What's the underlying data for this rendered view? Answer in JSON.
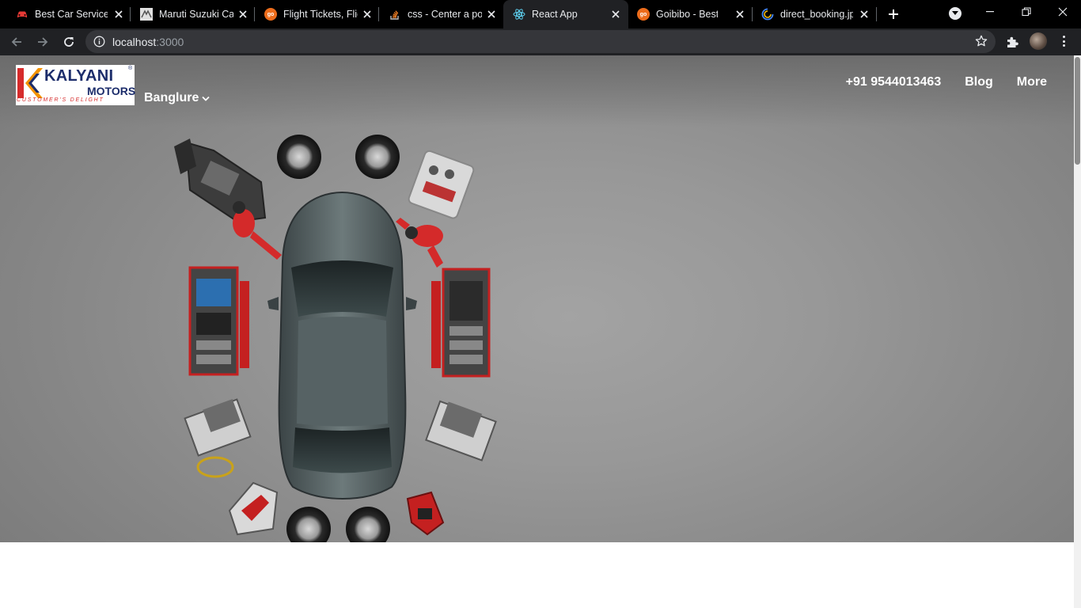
{
  "browser": {
    "tabs": [
      {
        "title": "Best Car Service |",
        "icon": "car-icon",
        "active": false
      },
      {
        "title": "Maruti Suzuki Car",
        "icon": "maruti-suzuki-icon",
        "active": false
      },
      {
        "title": "Flight Tickets, Flig",
        "icon": "goibibo-icon",
        "active": false
      },
      {
        "title": "css - Center a pos",
        "icon": "stackoverflow-icon",
        "active": false
      },
      {
        "title": "React App",
        "icon": "react-icon",
        "active": true
      },
      {
        "title": "Goibibo - Best Tra",
        "icon": "goibibo-icon",
        "active": false
      },
      {
        "title": "direct_booking.jp",
        "icon": "image-loading-icon",
        "active": false
      }
    ],
    "goibibo_icon_text": "go",
    "address": {
      "host": "localhost",
      "port": ":3000"
    }
  },
  "page": {
    "logo": {
      "name": "KALYANI",
      "sub": "MOTORS",
      "tagline": "CUSTOMER'S DELIGHT",
      "reg": "®"
    },
    "city": "Banglure",
    "nav": {
      "phone": "+91 9544013463",
      "blog": "Blog",
      "more": "More"
    },
    "colors": {
      "brand_blue": "#1c2d6b",
      "brand_red": "#d62b2b",
      "brand_orange": "#f39200"
    }
  }
}
